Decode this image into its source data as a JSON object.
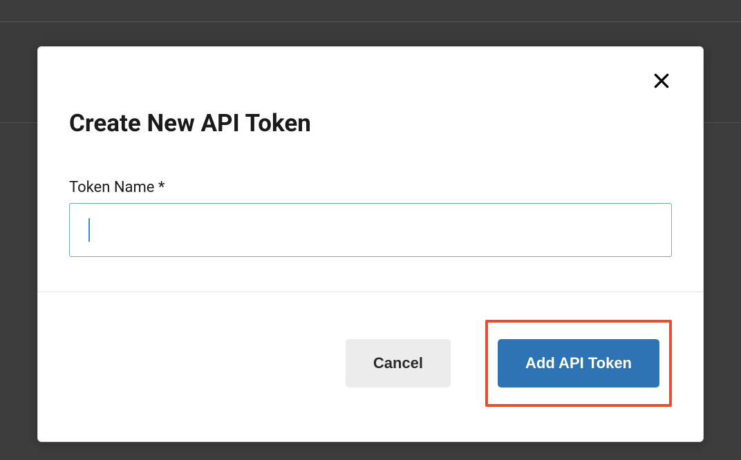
{
  "modal": {
    "title": "Create New API Token",
    "form": {
      "token_name_label": "Token Name *",
      "token_name_value": ""
    },
    "actions": {
      "cancel_label": "Cancel",
      "submit_label": "Add API Token"
    }
  }
}
